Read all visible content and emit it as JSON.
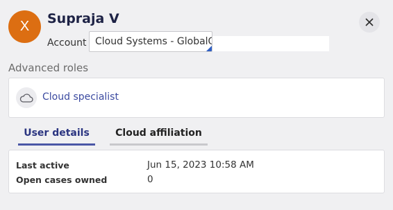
{
  "user": {
    "initial": "X",
    "name": "Supraja V",
    "avatar_color": "#dc6e12"
  },
  "account": {
    "label": "Account",
    "selected": "Cloud Systems - GlobalOps"
  },
  "advanced_roles": {
    "title": "Advanced roles",
    "items": [
      {
        "label": "Cloud specialist",
        "icon": "cloud-icon"
      }
    ]
  },
  "tabs": [
    {
      "label": "User details",
      "active": true
    },
    {
      "label": "Cloud affiliation",
      "active": false
    }
  ],
  "details": [
    {
      "label": "Last active",
      "value": "Jun 15, 2023 10:58 AM"
    },
    {
      "label": "Open cases owned",
      "value": "0"
    }
  ],
  "colors": {
    "accent": "#4a56a6",
    "link": "#3b4aa0",
    "title": "#1d2245"
  }
}
